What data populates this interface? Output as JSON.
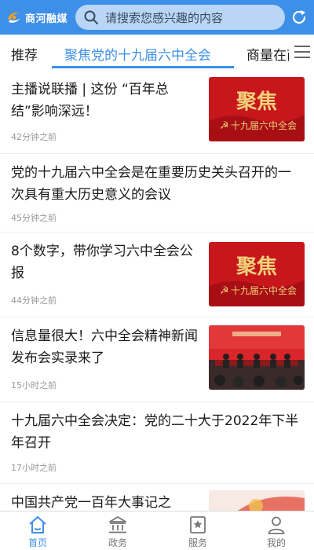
{
  "header": {
    "app_name": "商河融媒",
    "search_placeholder": "请搜索您感兴趣的内容"
  },
  "tabs": [
    {
      "label": "推荐"
    },
    {
      "label": "聚焦党的十九届六中全会"
    },
    {
      "label": "商量在商"
    }
  ],
  "thumb_text": {
    "focus_big": "聚焦",
    "plenum": "十九届六中全会"
  },
  "news": [
    {
      "title": "主播说联播 | 这份 “百年总结”影响深远！",
      "time": "42分钟之前",
      "thumb": "focus"
    },
    {
      "title": "党的十九届六中全会是在重要历史关头召开的一次具有重大历史意义的会议",
      "time": "45分钟之前",
      "thumb": "none"
    },
    {
      "title": "8个数字，带你学习六中全会公报",
      "time": "44分钟之前",
      "thumb": "focus"
    },
    {
      "title": "信息量很大！六中全会精神新闻发布会实录来了",
      "time": "15小时之前",
      "thumb": "press"
    },
    {
      "title": "十九届六中全会决定：党的二十大于2022年下半年召开",
      "time": "17小时之前",
      "thumb": "none"
    },
    {
      "title": "中国共产党一百年大事记之",
      "time": "",
      "thumb": "partial"
    }
  ],
  "bottom_nav": [
    {
      "label": "首页",
      "icon": "home-icon",
      "active": true
    },
    {
      "label": "政务",
      "icon": "government-building-icon",
      "active": false
    },
    {
      "label": "服务",
      "icon": "service-bookmark-icon",
      "active": false
    },
    {
      "label": "我的",
      "icon": "user-icon",
      "active": false
    }
  ],
  "colors": {
    "brand_blue": "#3d8fe8",
    "search_bg": "#b9d6f6",
    "thumb_red": "#c8161d",
    "gold": "#f2d27a"
  }
}
